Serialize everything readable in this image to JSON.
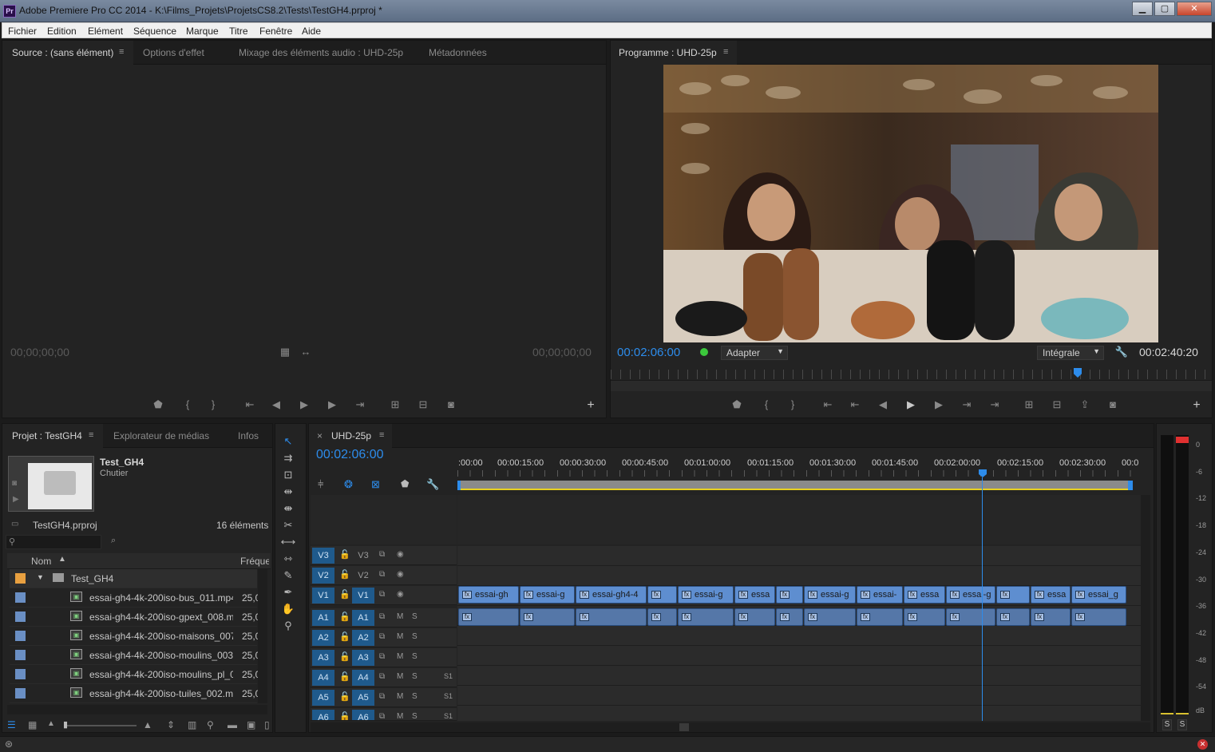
{
  "window": {
    "app_icon": "Pr",
    "title": "Adobe Premiere Pro CC 2014 - K:\\Films_Projets\\ProjetsCS8.2\\Tests\\TestGH4.prproj *",
    "minimize": "▁",
    "maximize": "▢",
    "close": "✕"
  },
  "menu": [
    "Fichier",
    "Edition",
    "Elément",
    "Séquence",
    "Marque",
    "Titre",
    "Fenêtre",
    "Aide"
  ],
  "source_panel": {
    "tabs": [
      "Source : (sans élément)",
      "Options d'effet",
      "Mixage des éléments audio : UHD-25p",
      "Métadonnées"
    ],
    "menu_glyph": "≡",
    "tc_left": "00;00;00;00",
    "tc_right": "00;00;00;00",
    "add": "+"
  },
  "program_panel": {
    "tab": "Programme : UHD-25p",
    "menu_glyph": "≡",
    "timecode": "00:02:06:00",
    "zoom": "Adapter",
    "quality": "Intégrale",
    "duration": "00:02:40:20",
    "add": "+",
    "playhead_fraction": 0.77
  },
  "project_panel": {
    "tabs": [
      "Projet : TestGH4",
      "Explorateur de médias",
      "Infos"
    ],
    "menu_glyph": "≡",
    "bin_name": "Test_GH4",
    "bin_type": "Chutier",
    "project_file": "TestGH4.prproj",
    "count": "16 éléments",
    "columns": [
      "Nom",
      "Fréque"
    ],
    "folder": "Test_GH4",
    "items": [
      {
        "name": "essai-gh4-4k-200iso-bus_011.mp4",
        "rate": "25,0"
      },
      {
        "name": "essai-gh4-4k-200iso-gpext_008.m",
        "rate": "25,0"
      },
      {
        "name": "essai-gh4-4k-200iso-maisons_007.",
        "rate": "25,0"
      },
      {
        "name": "essai-gh4-4k-200iso-moulins_003.",
        "rate": "25,0"
      },
      {
        "name": "essai-gh4-4k-200iso-moulins_pl_0",
        "rate": "25,0"
      },
      {
        "name": "essai-gh4-4k-200iso-tuiles_002.m",
        "rate": "25,0"
      }
    ]
  },
  "timeline": {
    "tab": "UHD-25p",
    "close": "×",
    "menu_glyph": "≡",
    "timecode": "00:02:06:00",
    "ruler": [
      ":00:00",
      "00:00:15:00",
      "00:00:30:00",
      "00:00:45:00",
      "00:01:00:00",
      "00:01:15:00",
      "00:01:30:00",
      "00:01:45:00",
      "00:02:00:00",
      "00:02:15:00",
      "00:02:30:00",
      "00:0"
    ],
    "video_tracks": [
      "V3",
      "V2",
      "V1"
    ],
    "audio_tracks": [
      "A1",
      "A2",
      "A3",
      "A4",
      "A5",
      "A6"
    ],
    "mute": "M",
    "solo": "S",
    "submix": "S1",
    "fx": "fx",
    "v1_clips": [
      "essai-gh",
      "essai-g",
      "essai-gh4-4",
      "",
      "essai-g",
      "essa",
      "",
      "essai-g",
      "essai-",
      "essa",
      "essai-g",
      "",
      "essa",
      "essai_g"
    ]
  },
  "meter": {
    "scale": [
      "0",
      "-6",
      "-12",
      "-18",
      "-24",
      "-30",
      "-36",
      "-42",
      "-48",
      "-54",
      "dB"
    ],
    "solo_left": "S",
    "solo_right": "S"
  },
  "colors": {
    "accent_blue": "#2d8ceb",
    "clip_video": "#5e8ed0",
    "clip_audio": "#5577a8",
    "track_target": "#1f5a8c",
    "label_orange": "#e8a040",
    "status_green": "#3cc83c"
  },
  "icons": {
    "selection": "arrow-icon",
    "ripple": "ripple-edit-icon",
    "razor": "razor-icon",
    "hand": "hand-icon",
    "zoom": "zoom-icon"
  }
}
